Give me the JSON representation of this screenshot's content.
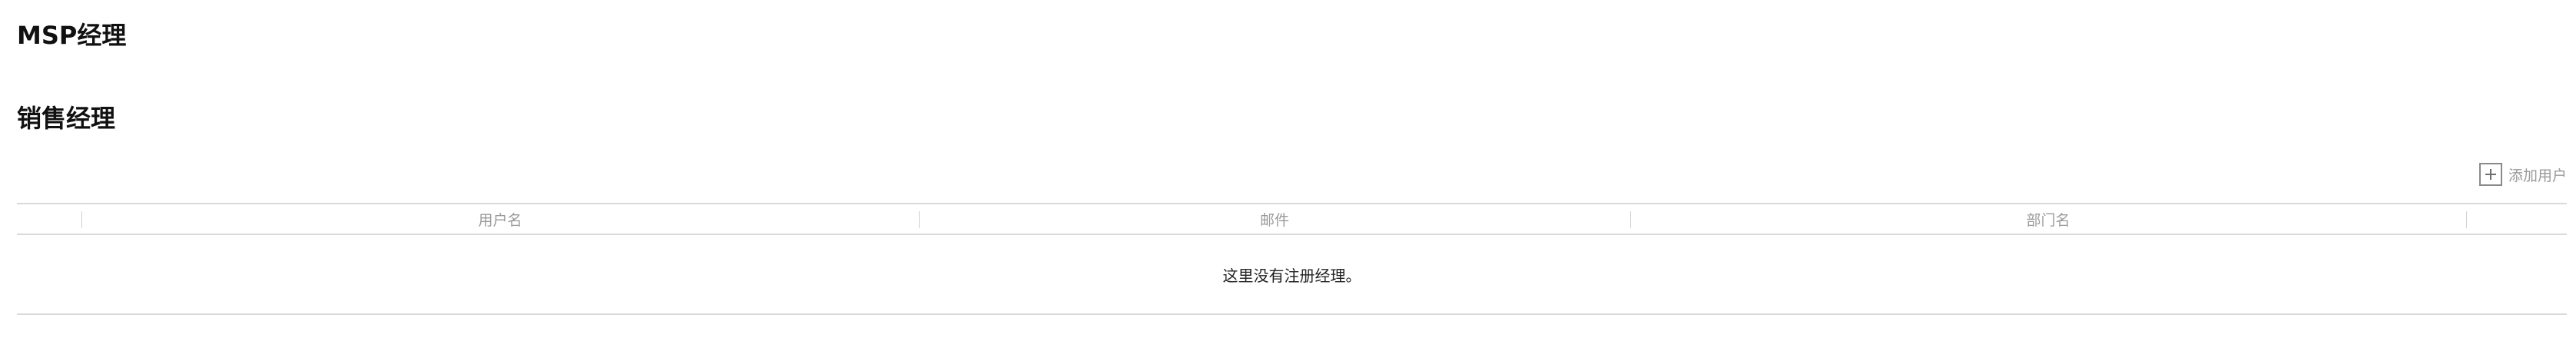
{
  "sections": {
    "msp_title": "MSP经理",
    "sales_title": "销售经理"
  },
  "toolbar": {
    "add_user_label": "添加用户",
    "add_user_icon": "plus-square-icon"
  },
  "table": {
    "columns": [
      "",
      "用户名",
      "邮件",
      "部门名",
      ""
    ],
    "empty_message": "这里没有注册经理。"
  },
  "colors": {
    "border": "#d9d9d9",
    "muted_text": "#9a9a9a",
    "title_text": "#111111"
  }
}
